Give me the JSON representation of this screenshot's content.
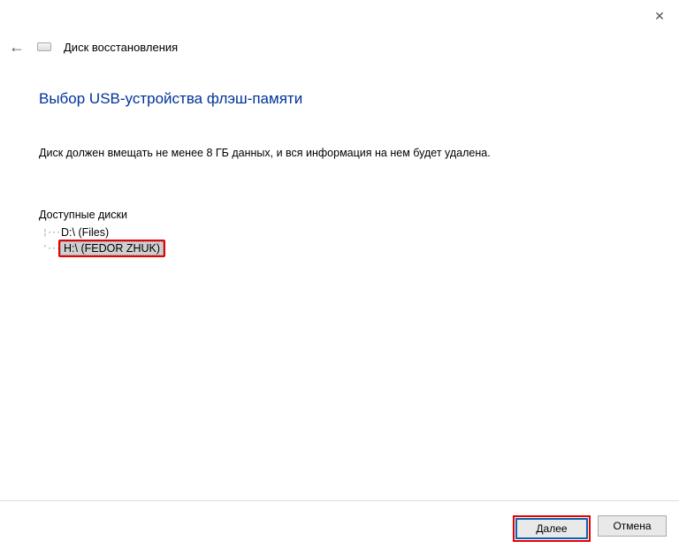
{
  "window": {
    "close_symbol": "✕"
  },
  "header": {
    "back_symbol": "←",
    "title": "Диск восстановления"
  },
  "main": {
    "heading": "Выбор USB-устройства флэш-памяти",
    "instruction": "Диск должен вмещать не менее 8 ГБ данных, и вся информация на нем будет удалена.",
    "drives_label": "Доступные диски",
    "drives": [
      {
        "label": "D:\\ (Files)",
        "selected": false
      },
      {
        "label": "H:\\ (FEDOR ZHUK)",
        "selected": true
      }
    ]
  },
  "footer": {
    "next_label": "Далее",
    "cancel_label": "Отмена"
  }
}
